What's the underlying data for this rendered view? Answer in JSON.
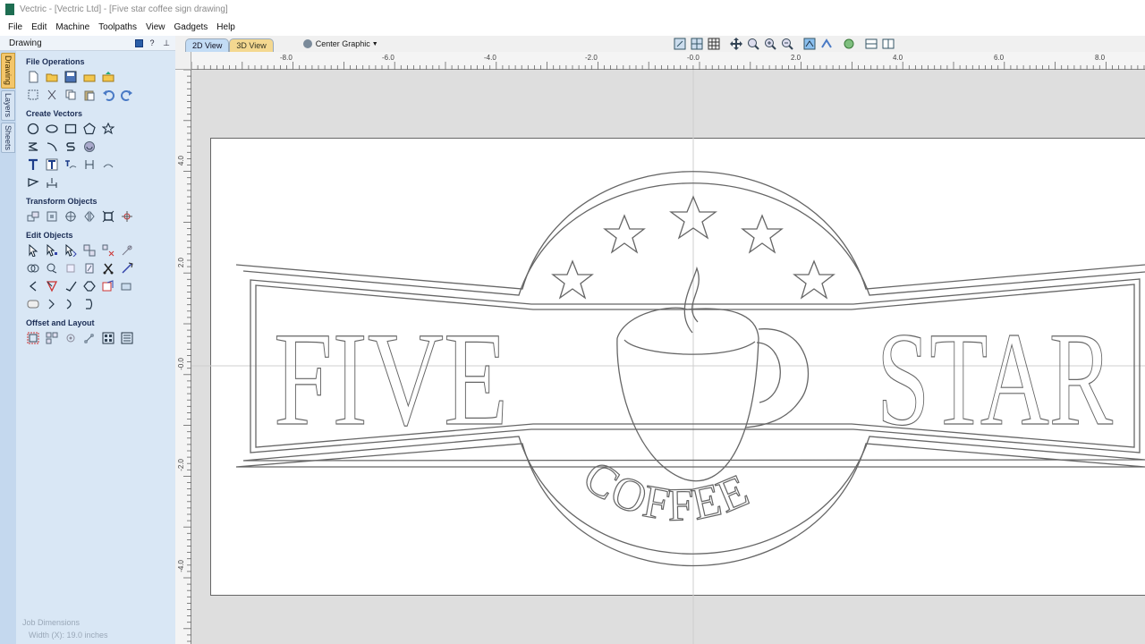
{
  "window": {
    "title": "Vectric - [Vectric Ltd] - [Five star coffee sign drawing]",
    "logo_color": "#1e6e52"
  },
  "menu": [
    "File",
    "Edit",
    "Machine",
    "Toolpaths",
    "View",
    "Gadgets",
    "Help"
  ],
  "panel": {
    "title": "Drawing",
    "tabs": [
      "Drawing",
      "Layers",
      "Sheets"
    ]
  },
  "sections": {
    "file_operations": "File Operations",
    "create_vectors": "Create Vectors",
    "transform_objects": "Transform Objects",
    "edit_objects": "Edit Objects",
    "offset_layout": "Offset and Layout"
  },
  "job": {
    "title": "Job Dimensions",
    "width": "Width  (X): 19.0 inches"
  },
  "view": {
    "tab_2d": "2D View",
    "tab_3d": "3D View",
    "center_graphic": "Center Graphic"
  },
  "ruler": {
    "h_labels": [
      "-8.0",
      "-6.0",
      "-4.0",
      "-2.0",
      "-0.0",
      "2.0",
      "4.0",
      "6.0",
      "8.0"
    ],
    "v_labels": [
      "4.0",
      "2.0",
      "-0.0",
      "-2.0",
      "-4.0"
    ]
  },
  "sign": {
    "word_left": "FIVE",
    "word_right": "STAR",
    "arc_text": "COFFEE"
  },
  "colors": {
    "accent_tab_2d": "#c3dcf5",
    "accent_tab_3d": "#f4d890",
    "panel_bg": "#d9e7f5",
    "active_sidetab": "#f4c66a"
  }
}
